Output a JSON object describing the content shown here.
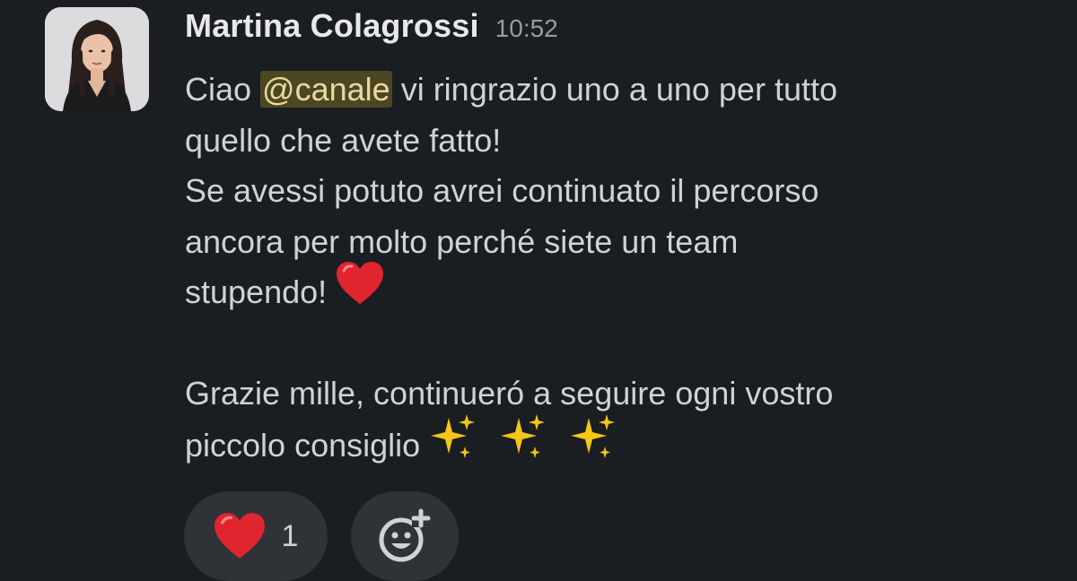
{
  "message": {
    "author": "Martina Colagrossi",
    "time": "10:52",
    "line1_before": "Ciao ",
    "mention": "@canale",
    "line1_after": " vi ringrazio uno a uno per tutto",
    "line2": "quello che avete fatto!",
    "line3": "Se avessi potuto avrei continuato il percorso",
    "line4": "ancora per molto perché siete un team",
    "line5": "stupendo! ",
    "line6": "Grazie mille, continueró a seguire ogni vostro",
    "line7": "piccolo consiglio ",
    "emoji_line5": "heart-emoji",
    "emoji_line7": [
      "sparkles-emoji",
      "sparkles-emoji",
      "sparkles-emoji"
    ]
  },
  "reactions": [
    {
      "emoji": "heart-emoji",
      "count": "1"
    }
  ],
  "add_reaction": {
    "icon": "add-reaction-icon"
  },
  "colors": {
    "background": "#1a1d21",
    "pill": "#2f3236",
    "mention_bg": "#4c4722",
    "heart": "#e0252e",
    "sparkle": "#f5c518"
  }
}
